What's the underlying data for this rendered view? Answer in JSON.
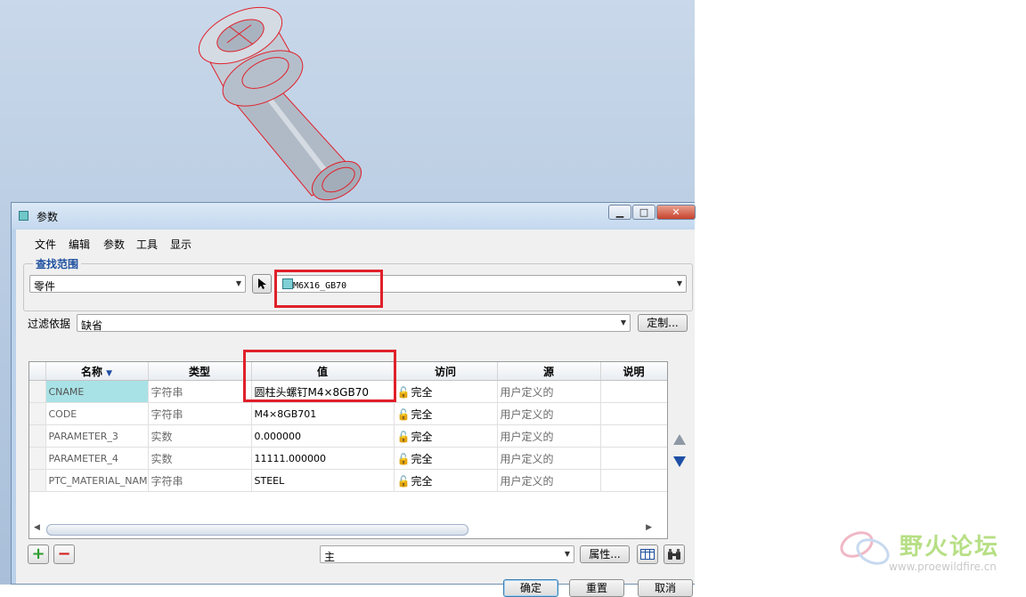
{
  "window": {
    "title": "参数",
    "controls": [
      "minimize",
      "maximize",
      "close"
    ]
  },
  "menu": [
    "文件",
    "编辑",
    "参数",
    "工具",
    "显示"
  ],
  "lookup": {
    "group_label": "查找范围",
    "scope_value": "零件",
    "model_value": "M6X16_GB70"
  },
  "filter": {
    "label": "过滤依据",
    "value": "缺省",
    "customize_label": "定制..."
  },
  "table": {
    "columns": [
      "名称",
      "类型",
      "值",
      "访问",
      "源",
      "说明"
    ],
    "rows": [
      {
        "name": "CNAME",
        "type": "字符串",
        "value": "圆柱头螺钉M4×8GB70",
        "access": "完全",
        "source": "用户定义的",
        "desc": ""
      },
      {
        "name": "CODE",
        "type": "字符串",
        "value": "M4×8GB701",
        "access": "完全",
        "source": "用户定义的",
        "desc": ""
      },
      {
        "name": "PARAMETER_3",
        "type": "实数",
        "value": "0.000000",
        "access": "完全",
        "source": "用户定义的",
        "desc": ""
      },
      {
        "name": "PARAMETER_4",
        "type": "实数",
        "value": "11111.000000",
        "access": "完全",
        "source": "用户定义的",
        "desc": ""
      },
      {
        "name": "PTC_MATERIAL_NAME",
        "type": "字符串",
        "value": "STEEL",
        "access": "完全",
        "source": "用户定义的",
        "desc": ""
      }
    ],
    "selected_row": 0
  },
  "bottom": {
    "add_label": "+",
    "remove_label": "−",
    "main_combo_value": "主",
    "properties_label": "属性..."
  },
  "actions": {
    "ok": "确定",
    "reset": "重置",
    "cancel": "取消"
  },
  "watermark": {
    "title": "野火论坛",
    "url": "www.proewildfire.cn"
  },
  "colors": {
    "highlight_box": "#e0202a",
    "selected_cell": "#a8e2e6",
    "group_label": "#1d4f9e"
  }
}
